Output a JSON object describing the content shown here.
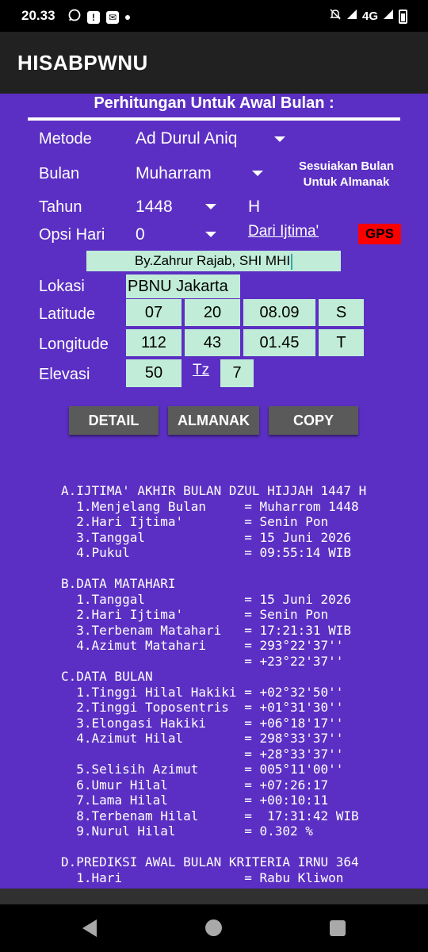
{
  "status": {
    "time": "20.33",
    "network": "4G",
    "icons_left": [
      "whatsapp-icon",
      "alert-icon",
      "mail-icon",
      "dot-icon"
    ],
    "icons_right": [
      "mute-icon",
      "signal-icon",
      "signal-icon",
      "battery-icon"
    ]
  },
  "app": {
    "title": "HISABPWNU"
  },
  "form": {
    "header": "Perhitungan Untuk Awal Bulan :",
    "metode": {
      "label": "Metode",
      "value": "Ad Durul Aniq"
    },
    "bulan": {
      "label": "Bulan",
      "value": "Muharram"
    },
    "note": "Sesuiakan Bulan\nUntuk Almanak",
    "tahun": {
      "label": "Tahun",
      "value": "1448",
      "suffix": "H"
    },
    "opsi_hari": {
      "label": "Opsi Hari",
      "value": "0"
    },
    "dari_ijtima": "Dari Ijtima'",
    "gps": "GPS",
    "author": "By.Zahrur Rajab, SHI MHI",
    "lokasi": {
      "label": "Lokasi",
      "value": "PBNU Jakarta"
    },
    "latitude": {
      "label": "Latitude",
      "deg": "07",
      "min": "20",
      "sec": "08.09",
      "dir": "S"
    },
    "longitude": {
      "label": "Longitude",
      "deg": "112",
      "min": "43",
      "sec": "01.45",
      "dir": "T"
    },
    "elevasi": {
      "label": "Elevasi",
      "value": "50"
    },
    "tz": {
      "label": "Tz",
      "value": "7"
    }
  },
  "buttons": {
    "detail": "DETAIL",
    "almanak": "ALMANAK",
    "copy": "COPY"
  },
  "result": "A.IJTIMA' AKHIR BULAN DZUL HIJJAH 1447 H\n  1.Menjelang Bulan     = Muharrom 1448\n  2.Hari Ijtima'        = Senin Pon\n  3.Tanggal             = 15 Juni 2026\n  4.Pukul               = 09:55:14 WIB\n\nB.DATA MATAHARI\n  1.Tanggal             = 15 Juni 2026\n  2.Hari Ijtima'        = Senin Pon\n  3.Terbenam Matahari   = 17:21:31 WIB\n  4.Azimut Matahari     = 293°22'37''\n                        = +23°22'37''\nC.DATA BULAN\n  1.Tinggi Hilal Hakiki = +02°32'50''\n  2.Tinggi Toposentris  = +01°31'30''\n  3.Elongasi Hakiki     = +06°18'17''\n  4.Azimut Hilal        = 298°33'37''\n                        = +28°33'37''\n  5.Selisih Azimut      = 005°11'00''\n  6.Umur Hilal          = +07:26:17\n  7.Lama Hilal          = +00:10:11\n  8.Terbenam Hilal      =  17:31:42 WIB\n  9.Nurul Hilal         = 0.302 %\n\nD.PREDIKSI AWAL BULAN KRITERIA IRNU 364\n  1.Hari                = Rabu Kliwon"
}
